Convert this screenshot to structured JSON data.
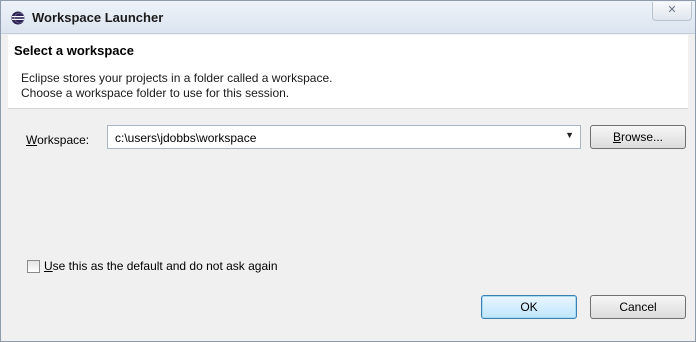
{
  "window": {
    "title": "Workspace Launcher",
    "close_glyph": "✕"
  },
  "banner": {
    "title": "Select a workspace",
    "line1": "Eclipse stores your projects in a folder called a workspace.",
    "line2": "Choose a workspace folder to use for this session."
  },
  "workspace": {
    "label_mnemonic": "W",
    "label_rest": "orkspace:",
    "value": "c:\\users\\jdobbs\\workspace",
    "dropdown_glyph": "▼"
  },
  "buttons": {
    "browse_mnemonic": "B",
    "browse_rest": "rowse...",
    "ok": "OK",
    "cancel": "Cancel"
  },
  "default_checkbox": {
    "mnemonic": "U",
    "label_rest": "se this as the default and do not ask again",
    "checked": false
  },
  "icons": {
    "title": "eclipse-icon",
    "close": "close-icon",
    "dropdown": "chevron-down-icon"
  }
}
